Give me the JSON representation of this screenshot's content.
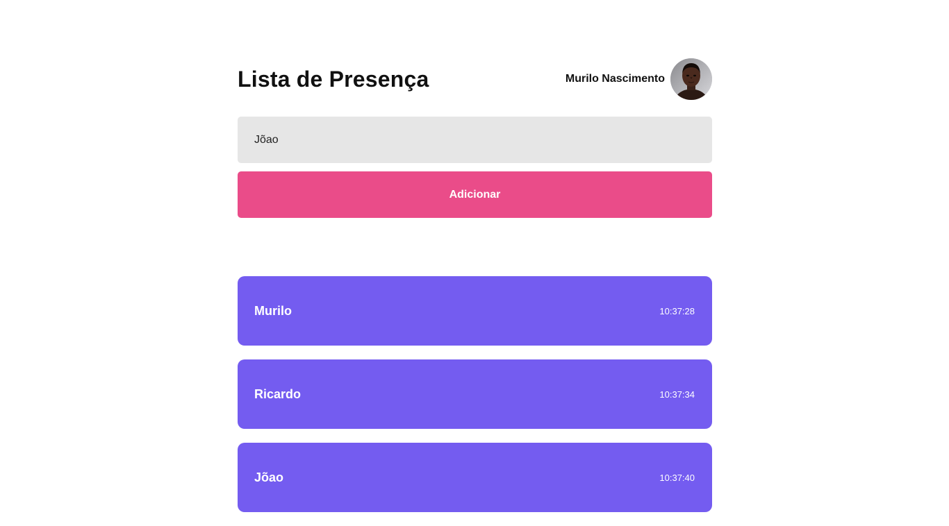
{
  "header": {
    "title": "Lista de Presença",
    "user_name": "Murilo Nascimento",
    "avatar_icon": "user-avatar-photo"
  },
  "form": {
    "input_value": "Jõao",
    "button_label": "Adicionar"
  },
  "colors": {
    "button": "#ea4c89",
    "card": "#745cf0",
    "input_bg": "#e6e6e6"
  },
  "students": [
    {
      "name": "Murilo",
      "time": "10:37:28"
    },
    {
      "name": "Ricardo",
      "time": "10:37:34"
    },
    {
      "name": "Jõao",
      "time": "10:37:40"
    }
  ]
}
